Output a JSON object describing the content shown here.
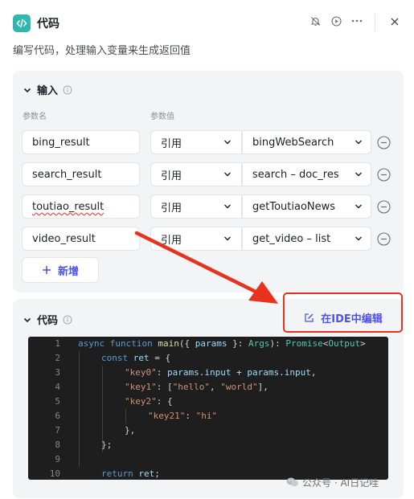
{
  "header": {
    "title": "代码",
    "description": "编写代码，处理输入变量来生成返回值"
  },
  "input_section": {
    "title": "输入",
    "col_name": "参数名",
    "col_value": "参数值",
    "rows": [
      {
        "name": "bing_result",
        "type": "引用",
        "value": "bingWebSearch"
      },
      {
        "name": "search_result",
        "type": "引用",
        "value": "search – doc_res"
      },
      {
        "name": "toutiao_result",
        "type": "引用",
        "value": "getToutiaoNews"
      },
      {
        "name": "video_result",
        "type": "引用",
        "value": "get_video – list"
      }
    ],
    "add_label": "新增"
  },
  "code_section": {
    "title": "代码",
    "ide_button": "在IDE中编辑",
    "line_numbers": [
      "1",
      "2",
      "3",
      "4",
      "5",
      "6",
      "7",
      "8",
      "9",
      "10"
    ]
  },
  "code_tokens": {
    "l1": [
      "async",
      " ",
      "function",
      " ",
      "main",
      "({ ",
      "params",
      " }: ",
      "Args",
      "): ",
      "Promise",
      "<",
      "Output",
      ">"
    ],
    "l2": [
      "const",
      " ",
      "ret",
      " = {"
    ],
    "l3": [
      "\"key0\"",
      ": ",
      "params",
      ".",
      "input",
      " + ",
      "params",
      ".",
      "input",
      ","
    ],
    "l4": [
      "\"key1\"",
      ": [",
      "\"hello\"",
      ", ",
      "\"world\"",
      "],"
    ],
    "l5": [
      "\"key2\"",
      ": {"
    ],
    "l6": [
      "\"key21\"",
      ": ",
      "\"hi\""
    ],
    "l7": [
      "},"
    ],
    "l8": [
      "};"
    ],
    "l10": [
      "return",
      " ",
      "ret",
      ";"
    ]
  },
  "watermark": "公众号 · AI日记哇",
  "colors": {
    "accent": "#4d53e8",
    "annotation_red": "#e8321e",
    "app_icon": "#2fb8b0",
    "editor_bg": "#1e1e1e"
  }
}
